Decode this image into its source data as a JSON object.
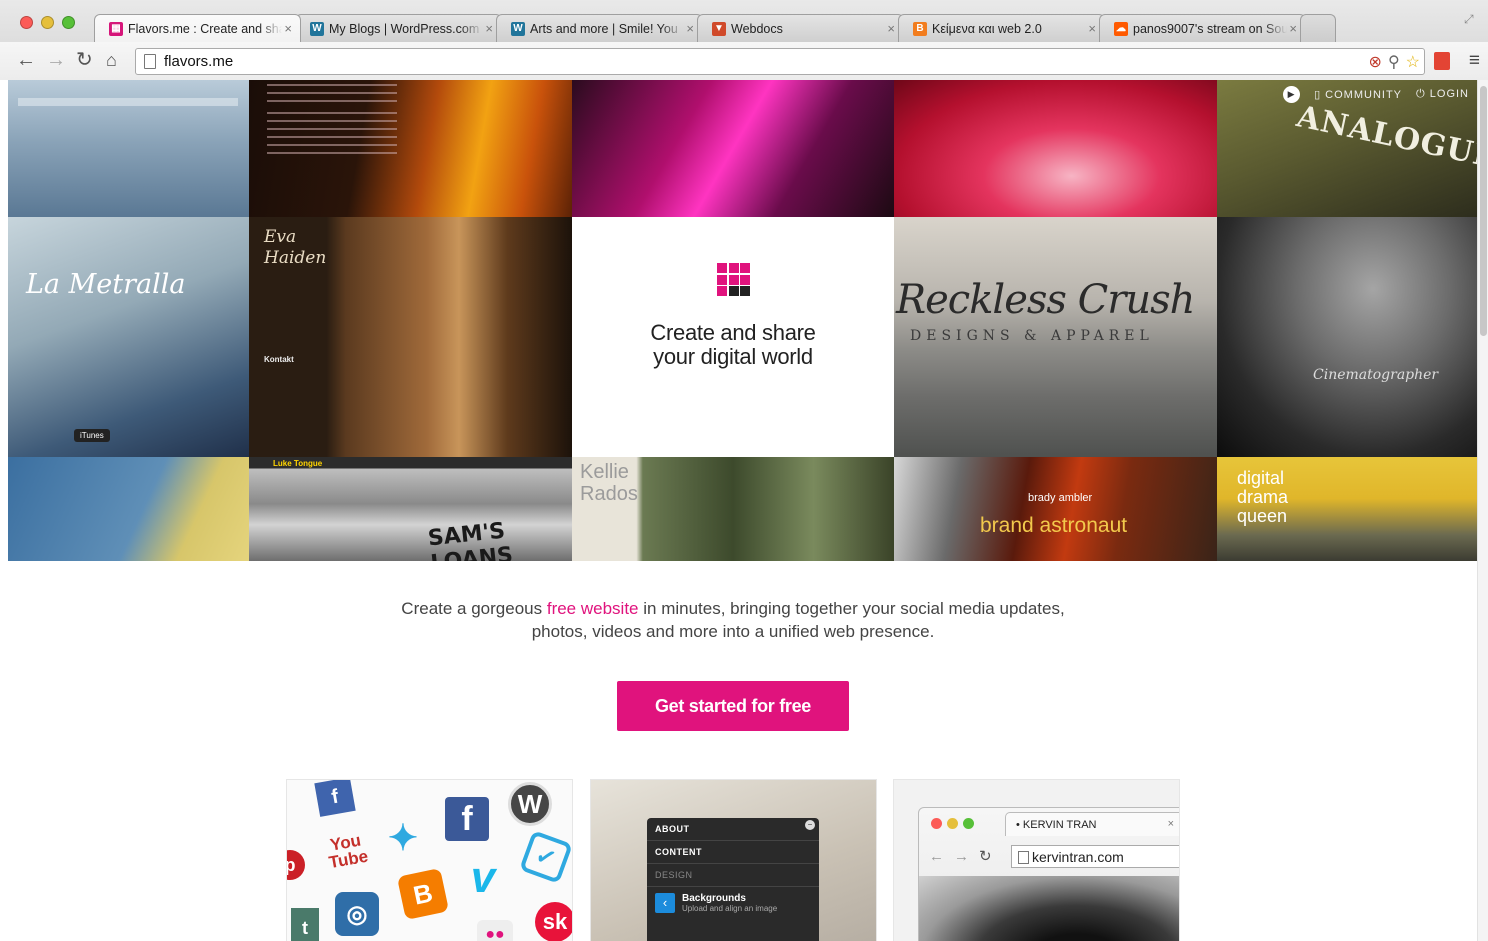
{
  "browser": {
    "tabs": [
      {
        "title": "Flavors.me : Create and share",
        "favicon": "flavors-icon",
        "color": "#d6167a",
        "active": true
      },
      {
        "title": "My Blogs | WordPress.com",
        "favicon": "wordpress-icon",
        "color": "#21759b",
        "active": false
      },
      {
        "title": "Arts and more | Smile! You",
        "favicon": "wordpress-icon",
        "color": "#21759b",
        "active": false
      },
      {
        "title": "Webdocs",
        "favicon": "webdocs-icon",
        "color": "#d04a2a",
        "active": false
      },
      {
        "title": "Κείμενα και web 2.0",
        "favicon": "blogger-icon",
        "color": "#f27d1e",
        "active": false
      },
      {
        "title": "panos9007's stream on Sou",
        "favicon": "soundcloud-icon",
        "color": "#ff5a00",
        "active": false
      }
    ],
    "url": "flavors.me"
  },
  "site": {
    "nav": {
      "community": "COMMUNITY",
      "login": "LOGIN"
    },
    "hero": {
      "line1": "Create and share",
      "line2": "your digital world"
    },
    "tagline_before": "Create a gorgeous ",
    "tagline_link": "free website",
    "tagline_after": " in minutes, bringing together your social media updates,",
    "tagline_line2": "photos, videos and more into a unified web presence.",
    "cta": "Get started for free",
    "accent_color": "#e0137d"
  },
  "mosaic": {
    "analogue": "ANALOGUE",
    "metralla": "La Metralla",
    "eva": "Eva Haiden",
    "eva_link": "Kontakt",
    "reckless": "Reckless Crush",
    "reckless_sub": "DESIGNS & APPAREL",
    "cinema_caption": "Cinematographer",
    "luke": "Luke Tongue",
    "loans": "SAM'S LOANS",
    "kellie": "Kellie Rados",
    "brady": "brady ambler",
    "brand": "brand astronaut",
    "digital": "digital drama queen",
    "itunes": "iTunes"
  },
  "cards": {
    "panel": {
      "about": "ABOUT",
      "content": "CONTENT",
      "design": "DESIGN",
      "bg_title": "Backgrounds",
      "bg_sub": "Upload and align an image"
    },
    "mini_browser": {
      "tab": "KERVIN TRAN",
      "url": "kervintran.com"
    },
    "social_labels": {
      "youtube": "You Tube",
      "facebook": "f",
      "vimeo": "v",
      "blogger": "B"
    }
  }
}
